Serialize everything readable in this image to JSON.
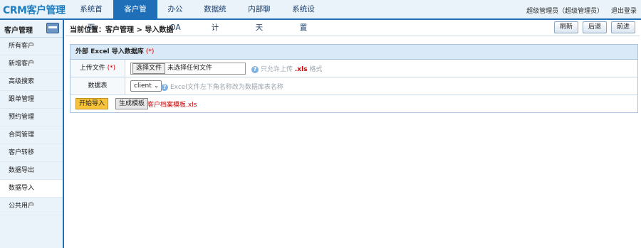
{
  "header": {
    "logo": "CRM客户管理",
    "nav": [
      "系统首页",
      "客户管理",
      "办公OA",
      "数据统计",
      "内部聊天",
      "系统设置"
    ],
    "active_nav": 1,
    "user": "超级管理员（超级管理员）",
    "logout": "退出登录"
  },
  "sidebar": {
    "title": "客户管理",
    "items": [
      "所有客户",
      "新增客户",
      "高级搜索",
      "跟单管理",
      "预约管理",
      "合同管理",
      "客户转移",
      "数据导出",
      "数据导入",
      "公共用户"
    ],
    "active_index": 8
  },
  "main": {
    "breadcrumb": "当前位置：客户管理 > 导入数据",
    "buttons": {
      "refresh": "刷新",
      "back": "后退",
      "forward": "前进"
    },
    "panel": {
      "title": "外部 Excel 导入数据库",
      "required_mark": "(*)",
      "upload_label": "上传文件",
      "file_button": "选择文件",
      "file_status": "未选择任何文件",
      "upload_hint_prefix": "只允许上传",
      "upload_hint_ext": ".xls",
      "upload_hint_suffix": "格式",
      "table_label": "数据表",
      "table_selected": "client",
      "table_hint": "Excel文件左下角名称改为数据库表名称",
      "start_button": "开始导入",
      "generate_button": "生成模板",
      "template_link": "客户档案模板.xls"
    }
  },
  "colors": {
    "accent": "#1e6fb8",
    "header_bg": "#eaf3fa",
    "required": "#cc0000",
    "import_button": "#f6c33b"
  },
  "icons": [
    "card-icon",
    "help-icon",
    "chevron-down-icon"
  ]
}
